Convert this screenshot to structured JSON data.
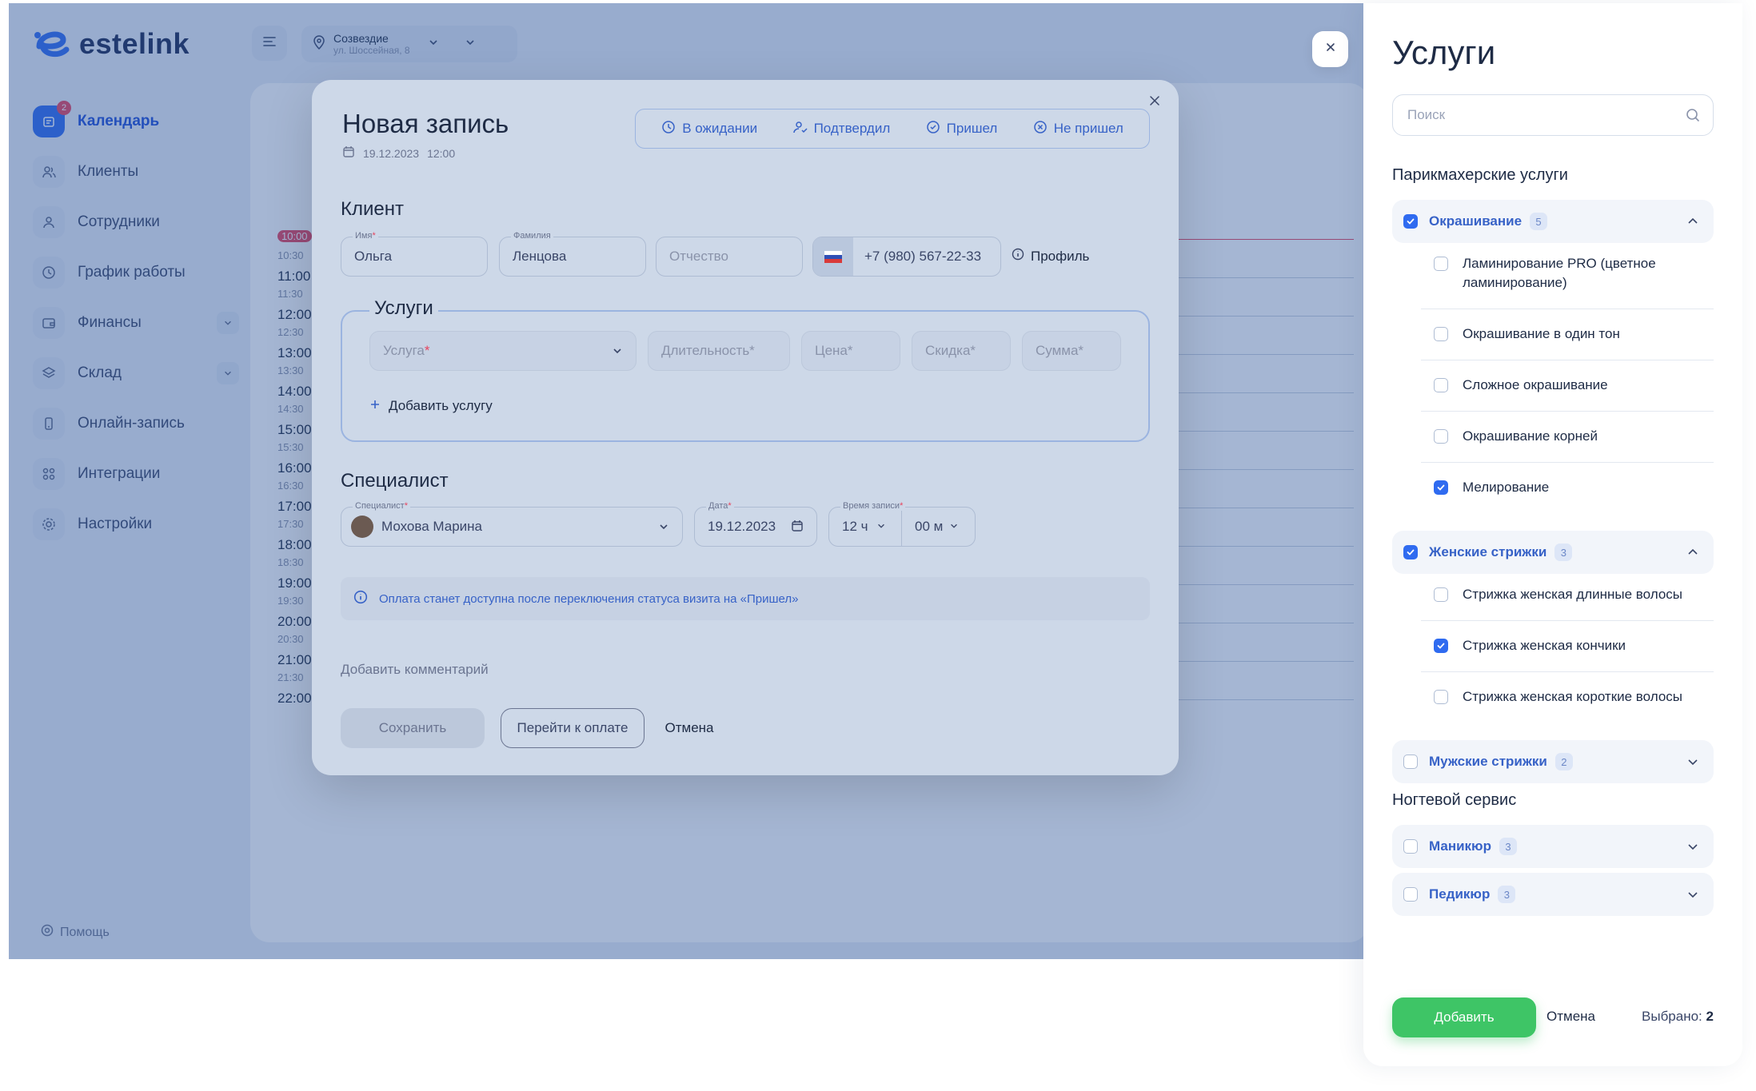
{
  "app": {
    "logo_text": "estelink",
    "location": {
      "title": "Созвездие",
      "subtitle": "ул. Шоссейная, 8"
    },
    "help_label": "Помощь",
    "nav": [
      {
        "label": "Календарь",
        "icon": "calendar-icon",
        "active": true,
        "badge": "2"
      },
      {
        "label": "Клиенты",
        "icon": "clients-icon"
      },
      {
        "label": "Сотрудники",
        "icon": "staff-icon"
      },
      {
        "label": "График работы",
        "icon": "clock-icon"
      },
      {
        "label": "Финансы",
        "icon": "wallet-icon",
        "expandable": true
      },
      {
        "label": "Склад",
        "icon": "warehouse-icon",
        "expandable": true
      },
      {
        "label": "Онлайн-запись",
        "icon": "phone-icon"
      },
      {
        "label": "Интеграции",
        "icon": "integrations-icon"
      },
      {
        "label": "Настройки",
        "icon": "gear-icon"
      }
    ],
    "times": [
      "10:00",
      "10:30",
      "11:00",
      "11:30",
      "12:00",
      "12:30",
      "13:00",
      "13:30",
      "14:00",
      "14:30",
      "15:00",
      "15:30",
      "16:00",
      "16:30",
      "17:00",
      "17:30",
      "18:00",
      "18:30",
      "19:00",
      "19:30",
      "20:00",
      "20:30",
      "21:00",
      "21:30",
      "22:00"
    ]
  },
  "modal": {
    "title": "Новая запись",
    "date": "19.12.2023",
    "time": "12:00",
    "statuses": [
      "В ожидании",
      "Подтвердил",
      "Пришел",
      "Не пришел"
    ],
    "client_heading": "Клиент",
    "client": {
      "first_name_label": "Имя",
      "first_name": "Ольга",
      "last_name_label": "Фамилия",
      "last_name": "Ленцова",
      "middle_name_placeholder": "Отчество",
      "phone": "+7 (980) 567-22-33",
      "profile_label": "Профиль"
    },
    "services_heading": "Услуги",
    "service_fields": {
      "service": "Услуга",
      "duration": "Длительность*",
      "price": "Цена*",
      "discount": "Скидка*",
      "sum": "Сумма*"
    },
    "add_service_label": "Добавить услугу",
    "specialist_heading": "Специалист",
    "specialist": {
      "label": "Специалист",
      "name": "Мохова Марина",
      "date_label": "Дата",
      "date": "19.12.2023",
      "time_label": "Время записи",
      "hours": "12 ч",
      "minutes": "00 м"
    },
    "info": "Оплата станет доступна после переключения статуса визита на «Пришел»",
    "add_comment": "Добавить комментарий",
    "save_label": "Сохранить",
    "pay_label": "Перейти к оплате",
    "cancel_label": "Отмена"
  },
  "panel": {
    "title": "Услуги",
    "search_placeholder": "Поиск",
    "groups": [
      {
        "name": "Парикмахерские услуги",
        "categories": [
          {
            "name": "Окрашивание",
            "count": "5",
            "checked": true,
            "expanded": true,
            "items": [
              {
                "name": "Ламинирование PRO (цветное ламинирование)",
                "checked": false
              },
              {
                "name": "Окрашивание в один тон",
                "checked": false
              },
              {
                "name": "Сложное окрашивание",
                "checked": false
              },
              {
                "name": "Окрашивание корней",
                "checked": false
              },
              {
                "name": "Мелирование",
                "checked": true
              }
            ]
          },
          {
            "name": "Женские стрижки",
            "count": "3",
            "checked": true,
            "expanded": true,
            "items": [
              {
                "name": "Стрижка женская длинные волосы",
                "checked": false
              },
              {
                "name": "Стрижка женская кончики",
                "checked": true
              },
              {
                "name": "Стрижка женская короткие волосы",
                "checked": false
              }
            ]
          },
          {
            "name": "Мужские стрижки",
            "count": "2",
            "checked": false,
            "expanded": false,
            "items": []
          }
        ]
      },
      {
        "name": "Ногтевой сервис",
        "categories": [
          {
            "name": "Маникюр",
            "count": "3",
            "checked": false,
            "expanded": false,
            "items": []
          },
          {
            "name": "Педикюр",
            "count": "3",
            "checked": false,
            "expanded": false,
            "items": []
          }
        ]
      }
    ],
    "add_label": "Добавить",
    "cancel_label": "Отмена",
    "selected_label": "Выбрано:",
    "selected_count": "2"
  },
  "colors": {
    "accent": "#2f6bf0",
    "success": "#3ec566",
    "danger": "#e7455f"
  }
}
